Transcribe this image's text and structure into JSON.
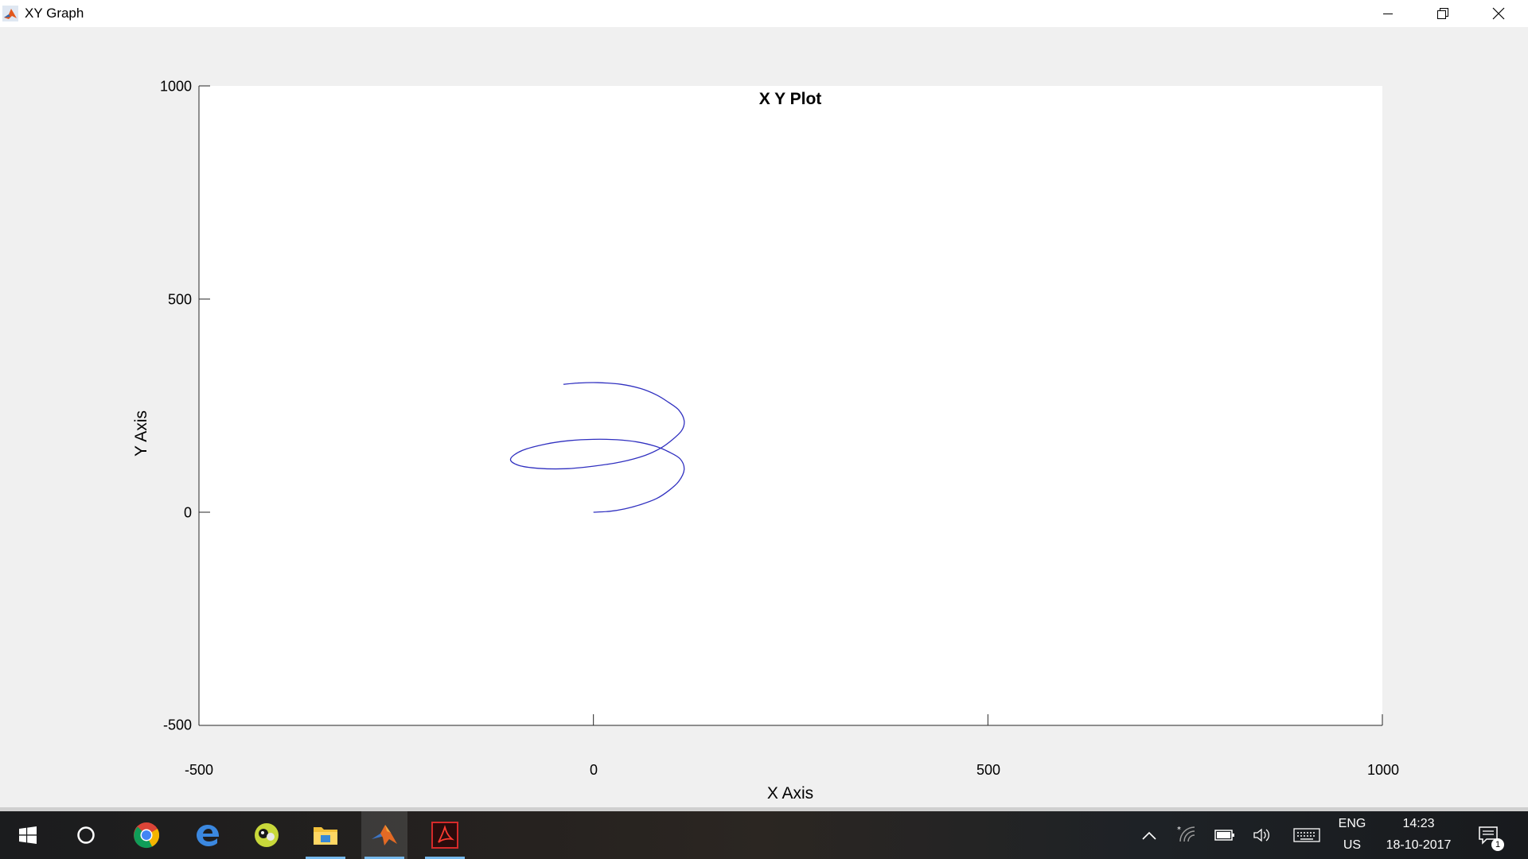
{
  "window": {
    "title": "XY Graph",
    "controls": [
      "minimize",
      "restore",
      "close"
    ]
  },
  "chart_data": {
    "type": "line",
    "title": "X Y Plot",
    "xlabel": "X Axis",
    "ylabel": "Y Axis",
    "xlim": [
      -500,
      1000
    ],
    "ylim": [
      -500,
      1000
    ],
    "xticks": [
      "-500",
      "0",
      "500",
      "1000"
    ],
    "yticks": [
      "-500",
      "0",
      "500",
      "1000"
    ],
    "grid": false,
    "line_color": "#3030c0",
    "series": [
      {
        "x": [
          0,
          20,
          40,
          60,
          80,
          95,
          108,
          115,
          110,
          95,
          78,
          55,
          30,
          0,
          -30,
          -60,
          -90,
          -105,
          -95,
          -70,
          -35,
          0,
          35,
          65,
          85,
          100,
          112,
          115,
          108,
          95,
          80,
          60,
          35,
          5,
          -20,
          -38
        ],
        "y": [
          0,
          2,
          8,
          18,
          32,
          50,
          72,
          100,
          125,
          142,
          155,
          165,
          170,
          171,
          168,
          160,
          145,
          125,
          110,
          103,
          102,
          108,
          118,
          133,
          150,
          170,
          192,
          215,
          240,
          258,
          275,
          290,
          300,
          304,
          303,
          300
        ]
      }
    ]
  },
  "taskbar": {
    "apps": [
      {
        "name": "start",
        "label": "Start"
      },
      {
        "name": "cortana",
        "label": "Search"
      },
      {
        "name": "chrome",
        "label": "Google Chrome"
      },
      {
        "name": "edge",
        "label": "Microsoft Edge"
      },
      {
        "name": "app-green",
        "label": "App"
      },
      {
        "name": "file-explorer",
        "label": "File Explorer"
      },
      {
        "name": "matlab",
        "label": "MATLAB"
      },
      {
        "name": "acrobat",
        "label": "Adobe Acrobat"
      }
    ],
    "tray": {
      "language": "ENG",
      "region": "US",
      "time": "14:23",
      "date": "18-10-2017",
      "notification_count": "1"
    }
  }
}
